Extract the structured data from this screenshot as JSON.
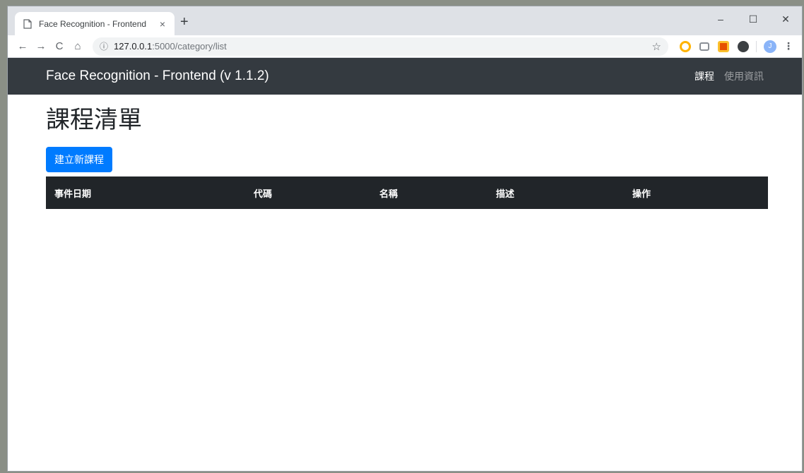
{
  "browser": {
    "tab_title": "Face Recognition - Frontend",
    "tab_close": "×",
    "new_tab": "+",
    "window_controls": {
      "minimize": "–",
      "maximize": "☐",
      "close": "✕"
    },
    "nav": {
      "back": "←",
      "forward": "→",
      "reload": "C",
      "home": "⌂"
    },
    "url_host": "127.0.0.1",
    "url_path": ":5000/category/list",
    "avatar_letter": "J"
  },
  "navbar": {
    "brand": "Face Recognition - Frontend (v 1.1.2)",
    "links": [
      "課程",
      "使用資訊"
    ]
  },
  "main": {
    "title": "課程清單",
    "create_button": "建立新課程",
    "table": {
      "headers": [
        "事件日期",
        "代碼",
        "名稱",
        "描述",
        "操作"
      ]
    }
  },
  "colors": {
    "navbar_bg": "#343a40",
    "primary": "#007bff",
    "table_header_bg": "#212529"
  }
}
